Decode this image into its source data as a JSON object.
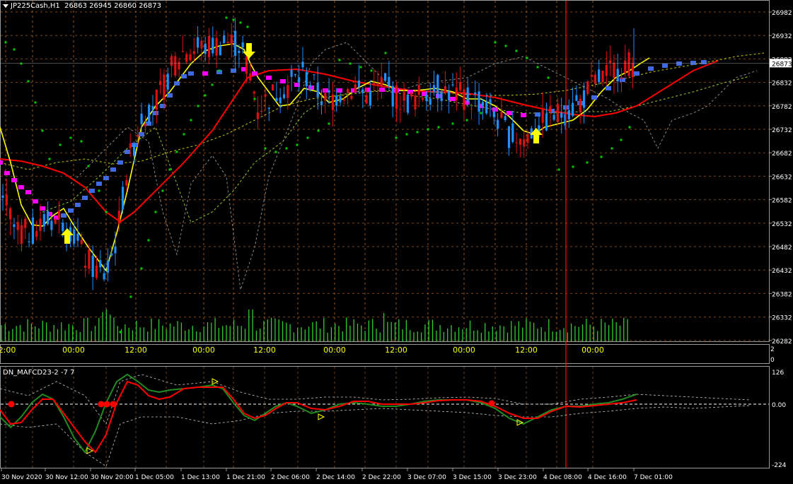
{
  "main_chart": {
    "symbol": "JP225Cash,H1",
    "ohlc": "26863 26945 26860 26873",
    "current_price": "26873",
    "price_ticks": [
      "26982",
      "26932",
      "26882",
      "26832",
      "26782",
      "26732",
      "26682",
      "26632",
      "26582",
      "26532",
      "26482",
      "26432",
      "26382",
      "26332",
      "26282"
    ],
    "time_ticks": [
      "2:00",
      "00:00",
      "12:00",
      "00:00",
      "12:00",
      "00:00",
      "12:00",
      "00:00",
      "12:00",
      "00:00"
    ]
  },
  "volume_panel": {
    "scale_top": "2",
    "scale_bottom": "0"
  },
  "indicator": {
    "name": "DN_MAFCD23-2 -7 7",
    "scale_top": "126",
    "scale_mid": "0.00",
    "scale_bottom": "-224"
  },
  "date_axis": [
    "30 Nov 2020",
    "30 Nov 12:00",
    "30 Nov 20:00",
    "1 Dec 05:00",
    "1 Dec 13:00",
    "1 Dec 21:00",
    "2 Dec 06:00",
    "2 Dec 14:00",
    "2 Dec 22:00",
    "3 Dec 07:00",
    "3 Dec 15:00",
    "3 Dec 23:00",
    "4 Dec 08:00",
    "4 Dec 16:00",
    "7 Dec 01:00"
  ],
  "colors": {
    "background": "#000000",
    "bull_candle": "#1e90ff",
    "bear_candle": "#e01010",
    "volume": "#32cd32",
    "psar": "#00cc00",
    "fast_ma": "#ffff00",
    "slow_ma": "#ff0000",
    "trend_up": "#4169e1",
    "trend_down": "#ff00ff",
    "grid": "#c87533",
    "cursor_line": "#ff0000",
    "arrow": "#ffff00"
  }
}
